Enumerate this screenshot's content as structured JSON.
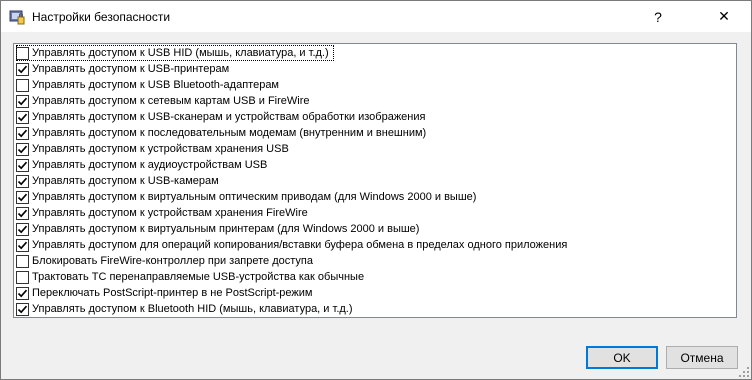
{
  "window": {
    "title": "Настройки безопасности",
    "help_label": "?",
    "close_label": "✕"
  },
  "options": [
    {
      "label": "Управлять доступом к USB HID (мышь, клавиатура, и т.д.)",
      "checked": false
    },
    {
      "label": "Управлять доступом к USB-принтерам",
      "checked": true
    },
    {
      "label": "Управлять доступом к USB Bluetooth-адаптерам",
      "checked": false
    },
    {
      "label": "Управлять доступом к сетевым картам USB и FireWire",
      "checked": true
    },
    {
      "label": "Управлять доступом к USB-сканерам и устройствам обработки изображения",
      "checked": true
    },
    {
      "label": "Управлять доступом к последовательным модемам (внутренним и внешним)",
      "checked": true
    },
    {
      "label": "Управлять доступом к устройствам хранения USB",
      "checked": true
    },
    {
      "label": "Управлять доступом к аудиоустройствам USB",
      "checked": true
    },
    {
      "label": "Управлять доступом к USB-камерам",
      "checked": true
    },
    {
      "label": "Управлять доступом к виртуальным оптическим приводам (для Windows 2000 и выше)",
      "checked": true
    },
    {
      "label": "Управлять доступом к устройствам хранения FireWire",
      "checked": true
    },
    {
      "label": "Управлять доступом к виртуальным принтерам (для Windows 2000 и выше)",
      "checked": true
    },
    {
      "label": "Управлять доступом для операций копирования/вставки буфера обмена в пределах одного приложения",
      "checked": true
    },
    {
      "label": "Блокировать FireWire-контроллер при запрете доступа",
      "checked": false
    },
    {
      "label": "Трактовать ТС перенаправляемые USB-устройства как обычные",
      "checked": false
    },
    {
      "label": "Переключать PostScript-принтер в не PostScript-режим",
      "checked": true
    },
    {
      "label": "Управлять доступом к Bluetooth HID (мышь, клавиатура, и т.д.)",
      "checked": true
    }
  ],
  "buttons": {
    "ok": "OK",
    "cancel": "Отмена"
  }
}
